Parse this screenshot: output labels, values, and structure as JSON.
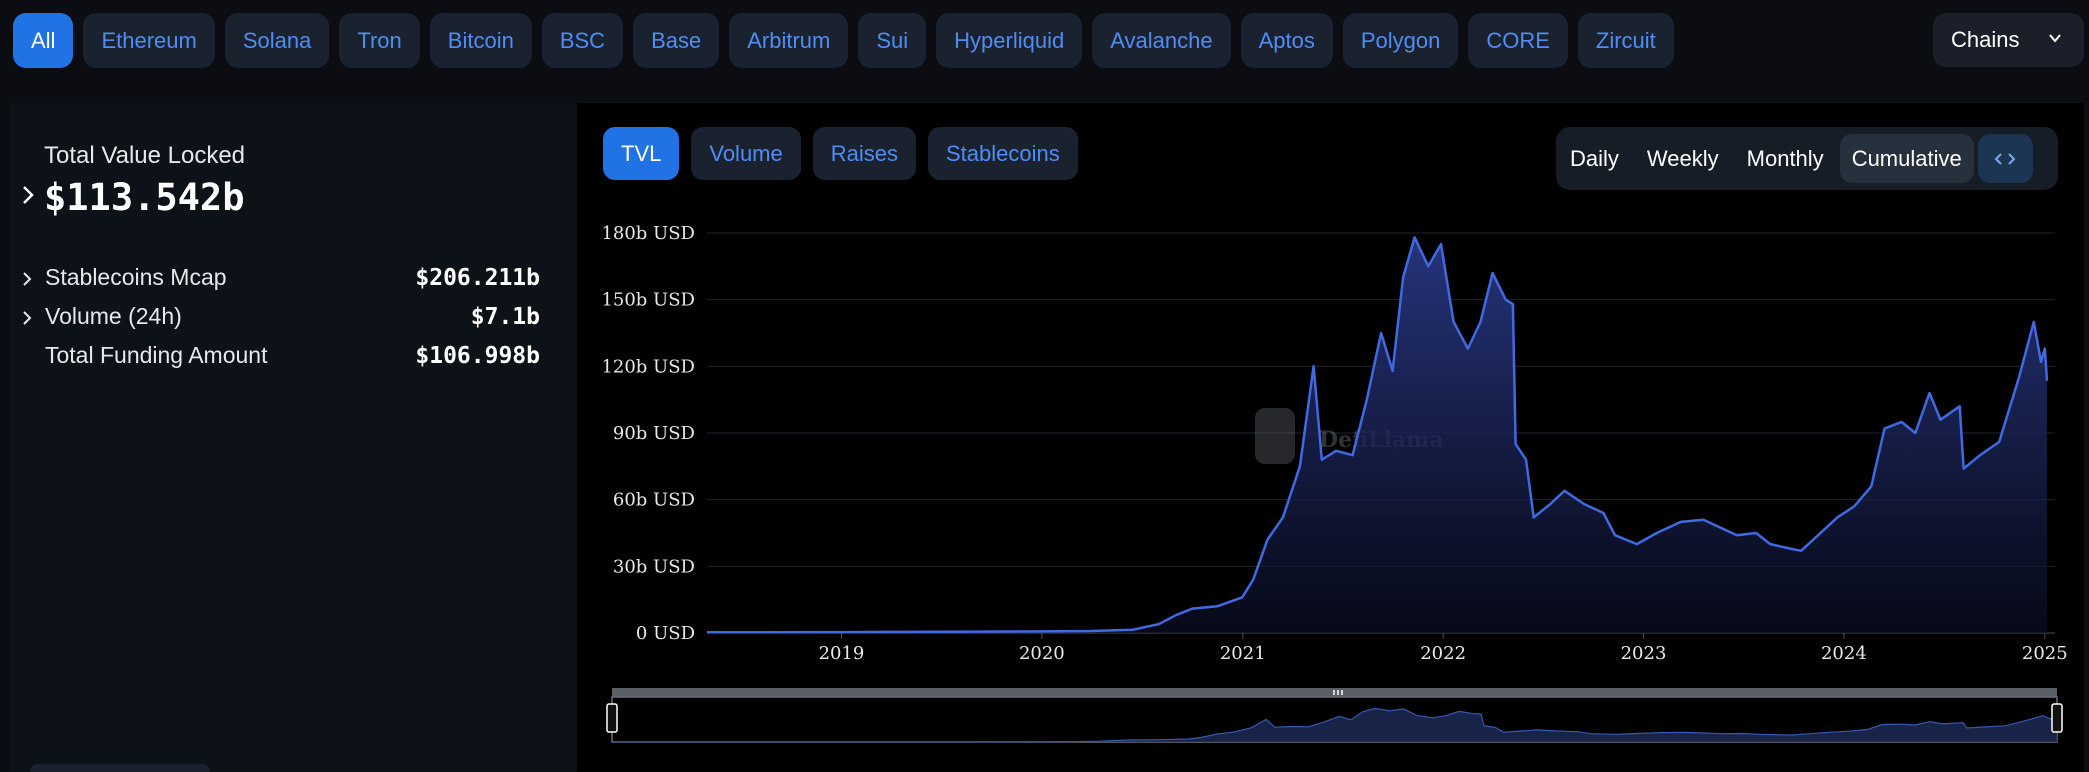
{
  "chain_filters": [
    {
      "label": "All",
      "active": true
    },
    {
      "label": "Ethereum"
    },
    {
      "label": "Solana"
    },
    {
      "label": "Tron"
    },
    {
      "label": "Bitcoin"
    },
    {
      "label": "BSC"
    },
    {
      "label": "Base"
    },
    {
      "label": "Arbitrum"
    },
    {
      "label": "Sui"
    },
    {
      "label": "Hyperliquid"
    },
    {
      "label": "Avalanche"
    },
    {
      "label": "Aptos"
    },
    {
      "label": "Polygon"
    },
    {
      "label": "CORE"
    },
    {
      "label": "Zircuit"
    }
  ],
  "chains_dropdown": {
    "label": "Chains",
    "icon": "chevron-down-icon"
  },
  "summary": {
    "tvl_label": "Total Value Locked",
    "tvl_value": "$113.542b",
    "metrics": [
      {
        "label": "Stablecoins Mcap",
        "value": "$206.211b",
        "expandable": true
      },
      {
        "label": "Volume (24h)",
        "value": "$7.1b",
        "expandable": true
      },
      {
        "label": "Total Funding Amount",
        "value": "$106.998b",
        "expandable": false
      }
    ]
  },
  "metric_tabs": [
    "TVL",
    "Volume",
    "Raises",
    "Stablecoins"
  ],
  "active_metric_tab": "TVL",
  "groupings": [
    "Daily",
    "Weekly",
    "Monthly",
    "Cumulative"
  ],
  "active_grouping": "Cumulative",
  "embed_icon": "code-brackets-icon",
  "watermark": {
    "text": "DefiLlama",
    "icon": "llama-logo-icon"
  },
  "colors": {
    "accent": "#2172e5",
    "line": "#4169e1",
    "pill_text": "#4f8df5"
  },
  "chart_data": {
    "type": "area",
    "title": "",
    "xlabel": "",
    "ylabel": "",
    "x_ticks": [
      "2019",
      "2020",
      "2021",
      "2022",
      "2023",
      "2024",
      "2025"
    ],
    "y_ticks": [
      "0 USD",
      "30b USD",
      "60b USD",
      "90b USD",
      "120b USD",
      "150b USD",
      "180b USD"
    ],
    "xlim": [
      "2018-05-01",
      "2025-01-05"
    ],
    "ylim": [
      0,
      180
    ],
    "grid": true,
    "legend": "none",
    "series": [
      {
        "values_unit": "billion USD",
        "points": [
          [
            "2018-05-01",
            0.3
          ],
          [
            "2019-01-01",
            0.4
          ],
          [
            "2019-07-01",
            0.6
          ],
          [
            "2020-01-01",
            0.7
          ],
          [
            "2020-04-01",
            0.9
          ],
          [
            "2020-06-15",
            1.5
          ],
          [
            "2020-08-01",
            4
          ],
          [
            "2020-09-01",
            8
          ],
          [
            "2020-10-01",
            11
          ],
          [
            "2020-11-15",
            12
          ],
          [
            "2020-12-31",
            16
          ],
          [
            "2021-01-20",
            24
          ],
          [
            "2021-02-15",
            42
          ],
          [
            "2021-03-15",
            52
          ],
          [
            "2021-04-15",
            75
          ],
          [
            "2021-05-10",
            120
          ],
          [
            "2021-05-25",
            78
          ],
          [
            "2021-06-20",
            82
          ],
          [
            "2021-07-20",
            80
          ],
          [
            "2021-08-15",
            105
          ],
          [
            "2021-09-10",
            135
          ],
          [
            "2021-10-01",
            118
          ],
          [
            "2021-10-20",
            160
          ],
          [
            "2021-11-10",
            178
          ],
          [
            "2021-12-05",
            165
          ],
          [
            "2021-12-28",
            175
          ],
          [
            "2022-01-20",
            140
          ],
          [
            "2022-02-15",
            128
          ],
          [
            "2022-03-10",
            140
          ],
          [
            "2022-04-01",
            162
          ],
          [
            "2022-04-25",
            150
          ],
          [
            "2022-05-08",
            148
          ],
          [
            "2022-05-13",
            85
          ],
          [
            "2022-06-01",
            78
          ],
          [
            "2022-06-15",
            52
          ],
          [
            "2022-07-15",
            58
          ],
          [
            "2022-08-10",
            64
          ],
          [
            "2022-09-15",
            58
          ],
          [
            "2022-10-20",
            54
          ],
          [
            "2022-11-10",
            44
          ],
          [
            "2022-12-20",
            40
          ],
          [
            "2023-01-25",
            45
          ],
          [
            "2023-03-10",
            50
          ],
          [
            "2023-04-20",
            51
          ],
          [
            "2023-05-25",
            47
          ],
          [
            "2023-06-20",
            44
          ],
          [
            "2023-07-25",
            45
          ],
          [
            "2023-08-20",
            40
          ],
          [
            "2023-09-25",
            38
          ],
          [
            "2023-10-15",
            37
          ],
          [
            "2023-11-15",
            44
          ],
          [
            "2023-12-20",
            52
          ],
          [
            "2024-01-20",
            57
          ],
          [
            "2024-02-20",
            66
          ],
          [
            "2024-03-15",
            92
          ],
          [
            "2024-04-15",
            95
          ],
          [
            "2024-05-10",
            90
          ],
          [
            "2024-06-05",
            108
          ],
          [
            "2024-06-25",
            96
          ],
          [
            "2024-07-30",
            102
          ],
          [
            "2024-08-06",
            74
          ],
          [
            "2024-09-05",
            80
          ],
          [
            "2024-10-10",
            86
          ],
          [
            "2024-11-15",
            115
          ],
          [
            "2024-12-12",
            140
          ],
          [
            "2024-12-25",
            122
          ],
          [
            "2025-01-01",
            128
          ],
          [
            "2025-01-05",
            113.5
          ]
        ]
      }
    ]
  }
}
